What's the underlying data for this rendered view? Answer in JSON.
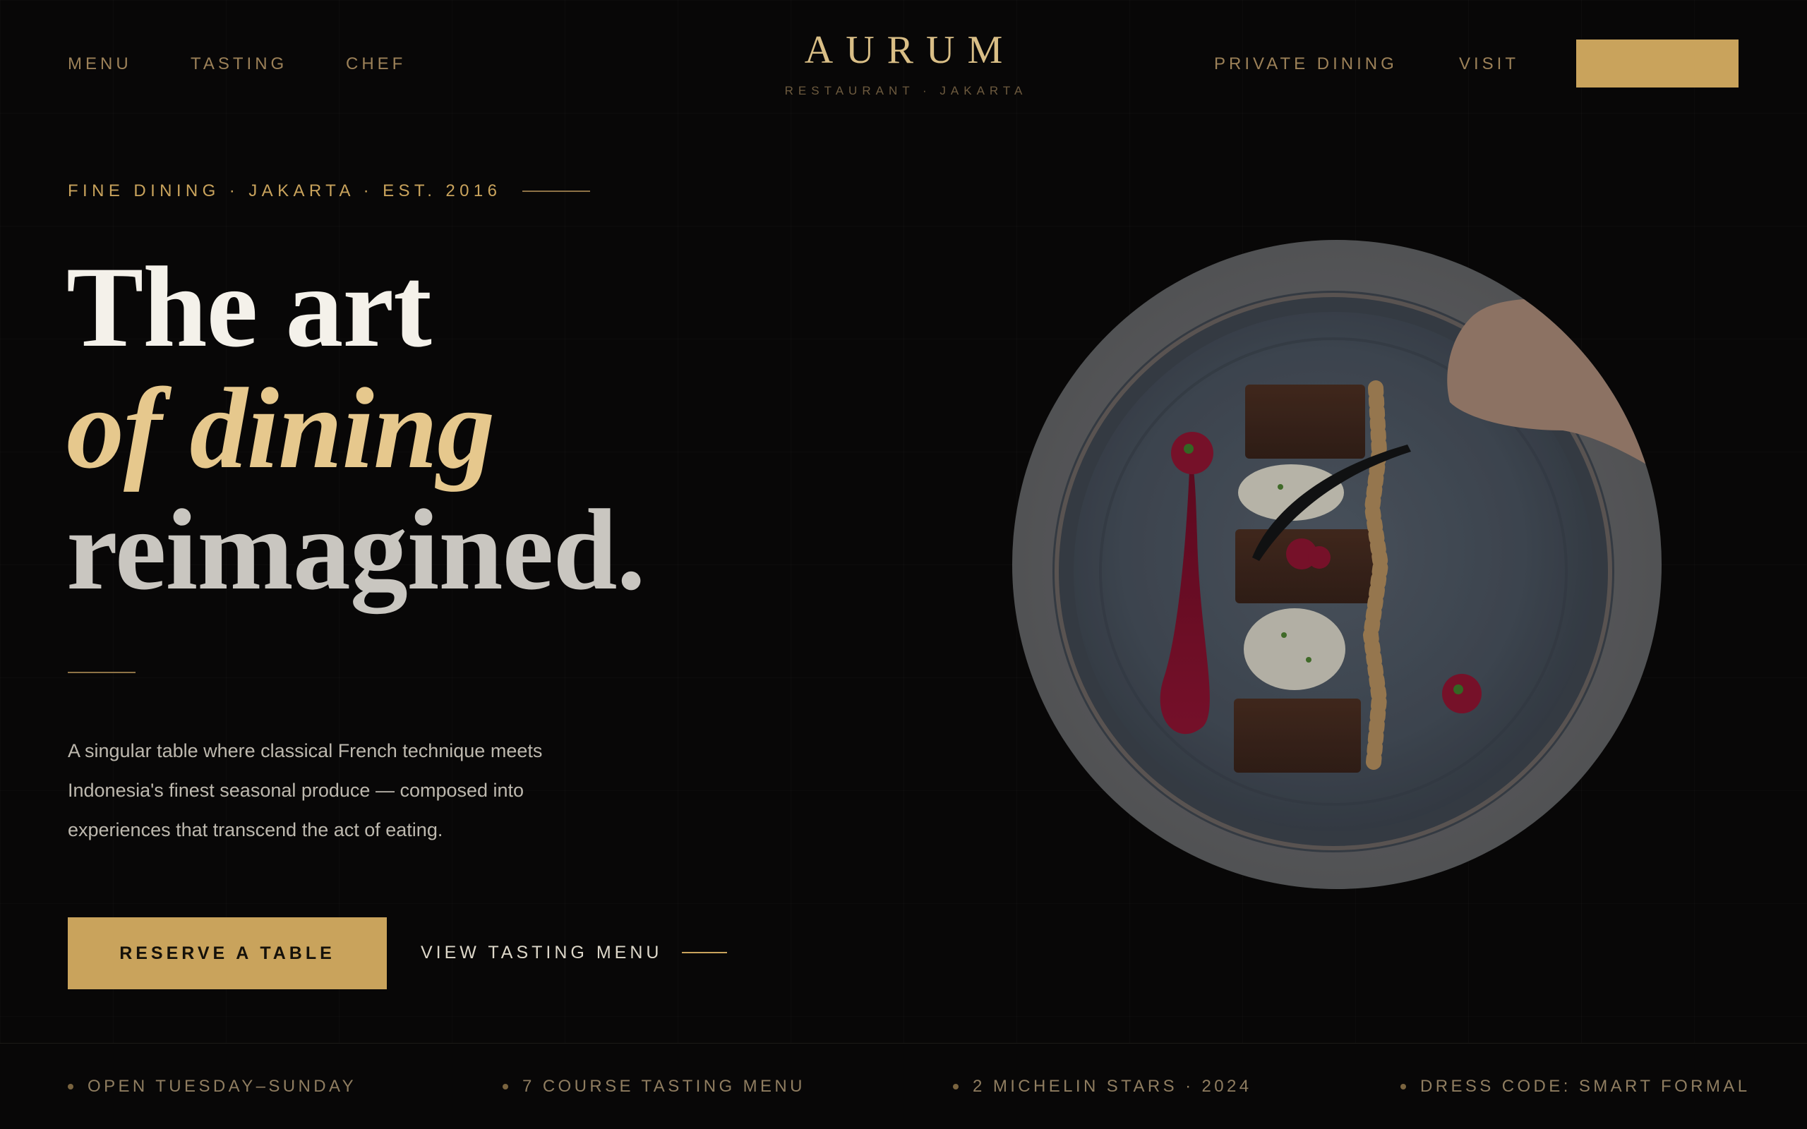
{
  "nav": {
    "left": [
      {
        "label": "MENU"
      },
      {
        "label": "TASTING"
      },
      {
        "label": "CHEF"
      }
    ],
    "right": [
      {
        "label": "PRIVATE DINING"
      },
      {
        "label": "VISIT"
      }
    ],
    "cta_label": ""
  },
  "brand": {
    "name": "AURUM",
    "subtitle": "RESTAURANT · JAKARTA"
  },
  "hero": {
    "eyebrow": "FINE DINING · JAKARTA · EST. 2016",
    "headline_line1": "The art",
    "headline_line2": "of dining",
    "headline_line3": "reimagined.",
    "lead_line1": "A singular table where classical French technique meets",
    "lead_line2": "Indonesia's finest seasonal produce — composed into",
    "lead_line3": "experiences that transcend the act of eating.",
    "primary_button": "RESERVE A TABLE",
    "secondary_button": "VIEW TASTING MENU"
  },
  "info_strip": [
    {
      "label": "OPEN TUESDAY–SUNDAY"
    },
    {
      "label": "7 COURSE TASTING MENU"
    },
    {
      "label": "2 MICHELIN STARS · 2024"
    },
    {
      "label": "DRESS CODE: SMART FORMAL"
    }
  ],
  "colors": {
    "background": "#080707",
    "accent_gold": "#c9a35c",
    "headline_light": "#f4f1ea",
    "headline_italic_gold": "#e6c88d"
  },
  "icons": {
    "secondary_arrow": "arrow-line-icon",
    "info_bullet": "dot-icon"
  }
}
